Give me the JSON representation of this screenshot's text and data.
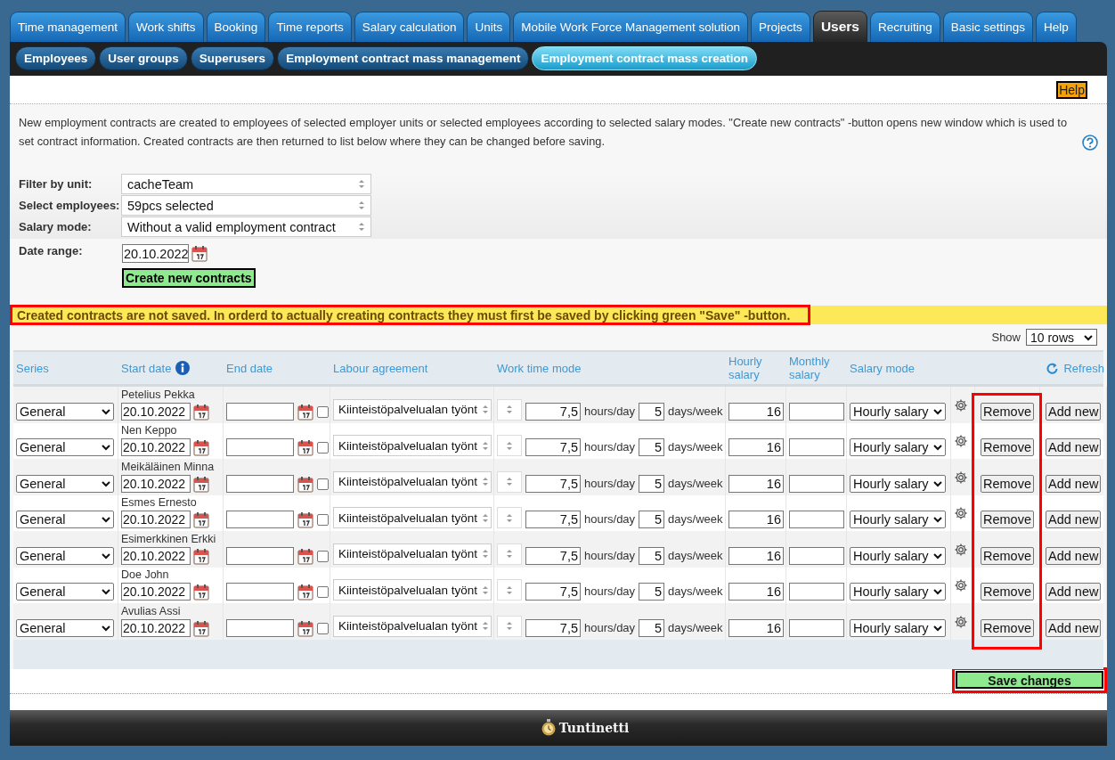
{
  "main_tabs": [
    {
      "label": "Time management",
      "selected": false
    },
    {
      "label": "Work shifts",
      "selected": false
    },
    {
      "label": "Booking",
      "selected": false
    },
    {
      "label": "Time reports",
      "selected": false
    },
    {
      "label": "Salary calculation",
      "selected": false
    },
    {
      "label": "Units",
      "selected": false
    },
    {
      "label": "Mobile Work Force Management solution",
      "selected": false
    },
    {
      "label": "Projects",
      "selected": false
    },
    {
      "label": "Users",
      "selected": true
    },
    {
      "label": "Recruiting",
      "selected": false
    },
    {
      "label": "Basic settings",
      "selected": false
    },
    {
      "label": "Help",
      "selected": false
    }
  ],
  "sub_tabs": [
    {
      "label": "Employees",
      "selected": false
    },
    {
      "label": "User groups",
      "selected": false
    },
    {
      "label": "Superusers",
      "selected": false
    },
    {
      "label": "Employment contract mass management",
      "selected": false
    },
    {
      "label": "Employment contract mass creation",
      "selected": true
    }
  ],
  "help_button": "Help",
  "description": "New employment contracts are created to employees of selected employer units or selected employees according to selected salary modes. \"Create new contracts\" -button opens new window which is used to set contract information. Created contracts are then returned to list below where they can be changed before saving.",
  "filters": [
    {
      "label": "Filter by unit:",
      "value": "cacheTeam"
    },
    {
      "label": "Select employees:",
      "value": "59pcs selected"
    },
    {
      "label": "Salary mode:",
      "value": "Without a valid employment contract"
    }
  ],
  "date_range": {
    "label": "Date range:",
    "value": "20.10.2022"
  },
  "create_button": "Create new contracts",
  "warning": {
    "text": "Created contracts are not saved. In orderd to actually creating contracts they must first be saved by clicking green \"Save\" -button.",
    "highlighted": true
  },
  "show": {
    "label": "Show",
    "value": "10 rows"
  },
  "table": {
    "columns": [
      "Series",
      "Start date",
      "End date",
      "Labour agreement",
      "Work time mode",
      "Hourly salary",
      "Monthly salary",
      "Salary mode"
    ],
    "refresh": "Refresh",
    "remove_highlighted": true,
    "rows": [
      {
        "employee": "Petelius Pekka",
        "series": "General",
        "start_date": "20.10.2022",
        "end_date_checked": false,
        "labour_agreement": "Kiinteistöpalvelualan työnt",
        "hours": "7,5",
        "hours_unit": "hours/day",
        "days": "5",
        "days_unit": "days/week",
        "hourly_salary": "16",
        "salary_mode": "Hourly salary",
        "remove": "Remove",
        "add": "Add new"
      },
      {
        "employee": "Nen Keppo",
        "series": "General",
        "start_date": "20.10.2022",
        "end_date_checked": false,
        "labour_agreement": "Kiinteistöpalvelualan työnt",
        "hours": "7,5",
        "hours_unit": "hours/day",
        "days": "5",
        "days_unit": "days/week",
        "hourly_salary": "16",
        "salary_mode": "Hourly salary",
        "remove": "Remove",
        "add": "Add new"
      },
      {
        "employee": "Meikäläinen Minna",
        "series": "General",
        "start_date": "20.10.2022",
        "end_date_checked": false,
        "labour_agreement": "Kiinteistöpalvelualan työnt",
        "hours": "7,5",
        "hours_unit": "hours/day",
        "days": "5",
        "days_unit": "days/week",
        "hourly_salary": "16",
        "salary_mode": "Hourly salary",
        "remove": "Remove",
        "add": "Add new"
      },
      {
        "employee": "Esmes Ernesto",
        "series": "General",
        "start_date": "20.10.2022",
        "end_date_checked": false,
        "labour_agreement": "Kiinteistöpalvelualan työnt",
        "hours": "7,5",
        "hours_unit": "hours/day",
        "days": "5",
        "days_unit": "days/week",
        "hourly_salary": "16",
        "salary_mode": "Hourly salary",
        "remove": "Remove",
        "add": "Add new"
      },
      {
        "employee": "Esimerkkinen Erkki",
        "series": "General",
        "start_date": "20.10.2022",
        "end_date_checked": false,
        "labour_agreement": "Kiinteistöpalvelualan työnt",
        "hours": "7,5",
        "hours_unit": "hours/day",
        "days": "5",
        "days_unit": "days/week",
        "hourly_salary": "16",
        "salary_mode": "Hourly salary",
        "remove": "Remove",
        "add": "Add new"
      },
      {
        "employee": "Doe John",
        "series": "General",
        "start_date": "20.10.2022",
        "end_date_checked": false,
        "labour_agreement": "Kiinteistöpalvelualan työnt",
        "hours": "7,5",
        "hours_unit": "hours/day",
        "days": "5",
        "days_unit": "days/week",
        "hourly_salary": "16",
        "salary_mode": "Hourly salary",
        "remove": "Remove",
        "add": "Add new"
      },
      {
        "employee": "Avulias Assi",
        "series": "General",
        "start_date": "20.10.2022",
        "end_date_checked": false,
        "labour_agreement": "Kiinteistöpalvelualan työnt",
        "hours": "7,5",
        "hours_unit": "hours/day",
        "days": "5",
        "days_unit": "days/week",
        "hourly_salary": "16",
        "salary_mode": "Hourly salary",
        "remove": "Remove",
        "add": "Add new"
      }
    ]
  },
  "save_button": {
    "label": "Save changes",
    "highlighted": true
  },
  "footer": {
    "brand": "Tuntinetti"
  }
}
